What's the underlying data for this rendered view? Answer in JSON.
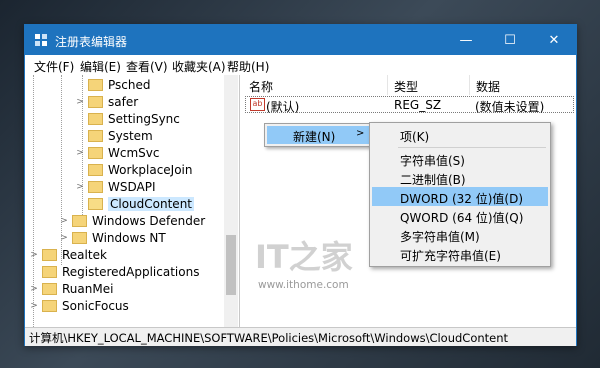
{
  "window": {
    "title": "注册表编辑器",
    "controls": {
      "minimize": "—",
      "maximize": "☐",
      "close": "✕"
    }
  },
  "menubar": [
    "文件(F)",
    "编辑(E)",
    "查看(V)",
    "收藏夹(A)",
    "帮助(H)"
  ],
  "tree": [
    {
      "label": "Psched",
      "arrow": ""
    },
    {
      "label": "safer",
      "arrow": ">"
    },
    {
      "label": "SettingSync",
      "arrow": ""
    },
    {
      "label": "System",
      "arrow": ""
    },
    {
      "label": "WcmSvc",
      "arrow": ">"
    },
    {
      "label": "WorkplaceJoin",
      "arrow": ""
    },
    {
      "label": "WSDAPI",
      "arrow": ">"
    },
    {
      "label": "CloudContent",
      "arrow": "",
      "selected": true
    },
    {
      "label": "Windows Defender",
      "arrow": ">"
    },
    {
      "label": "Windows NT",
      "arrow": ">"
    },
    {
      "label": "Realtek",
      "arrow": ">"
    },
    {
      "label": "RegisteredApplications",
      "arrow": ""
    },
    {
      "label": "RuanMei",
      "arrow": ">"
    },
    {
      "label": "SonicFocus",
      "arrow": ">"
    }
  ],
  "columns": {
    "name": "名称",
    "type": "类型",
    "data": "数据"
  },
  "values": [
    {
      "icon": "ab",
      "name": "(默认)",
      "type": "REG_SZ",
      "data": "(数值未设置)"
    }
  ],
  "context_menu": {
    "new_label": "新建(N)",
    "new_arrow": ">",
    "submenu": {
      "key": "项(K)",
      "items": [
        "字符串值(S)",
        "二进制值(B)",
        "DWORD (32 位)值(D)",
        "QWORD (64 位)值(Q)",
        "多字符串值(M)",
        "可扩充字符串值(E)"
      ],
      "highlighted": "DWORD (32 位)值(D)"
    }
  },
  "watermark": {
    "logo": "IT之家",
    "url": "www.ithome.com"
  },
  "statusbar": {
    "path": "计算机\\HKEY_LOCAL_MACHINE\\SOFTWARE\\Policies\\Microsoft\\Windows\\CloudContent"
  },
  "colors": {
    "titlebar": "#1e73be",
    "menu_highlight": "#91c9f7",
    "selection": "#cce8ff"
  }
}
